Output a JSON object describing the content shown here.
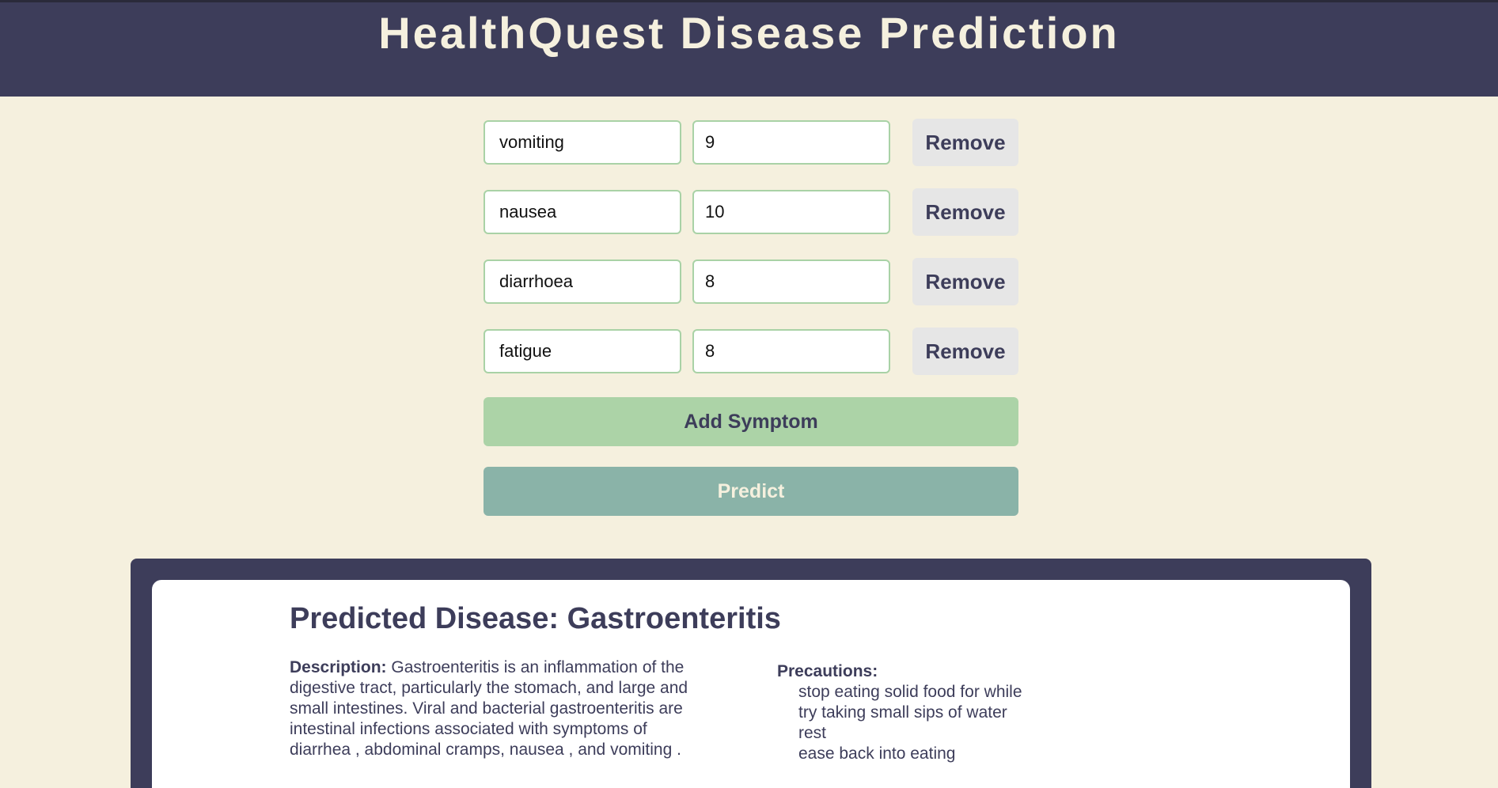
{
  "header": {
    "title": "HealthQuest Disease Prediction"
  },
  "symptoms": [
    {
      "name": "vomiting",
      "severity": "9",
      "remove_label": "Remove"
    },
    {
      "name": "nausea",
      "severity": "10",
      "remove_label": "Remove"
    },
    {
      "name": "diarrhoea",
      "severity": "8",
      "remove_label": "Remove"
    },
    {
      "name": "fatigue",
      "severity": "8",
      "remove_label": "Remove"
    }
  ],
  "actions": {
    "add_label": "Add Symptom",
    "predict_label": "Predict"
  },
  "result": {
    "title": "Predicted Disease: Gastroenteritis",
    "description_label": "Description:",
    "description": "Gastroenteritis is an inflammation of the digestive tract, particularly the stomach, and large and small intestines. Viral and bacterial gastroenteritis are intestinal infections associated with symptoms of diarrhea , abdominal cramps, nausea , and vomiting .",
    "precautions_label": "Precautions:",
    "precautions": [
      "stop eating solid food for while",
      "try taking small sips of water",
      "rest",
      "ease back into eating"
    ]
  },
  "colors": {
    "header_bg": "#3d3d5a",
    "page_bg": "#f5f0de",
    "add_button": "#acd3a7",
    "predict_button": "#8ab3a8",
    "input_border": "#a9d2a6"
  }
}
